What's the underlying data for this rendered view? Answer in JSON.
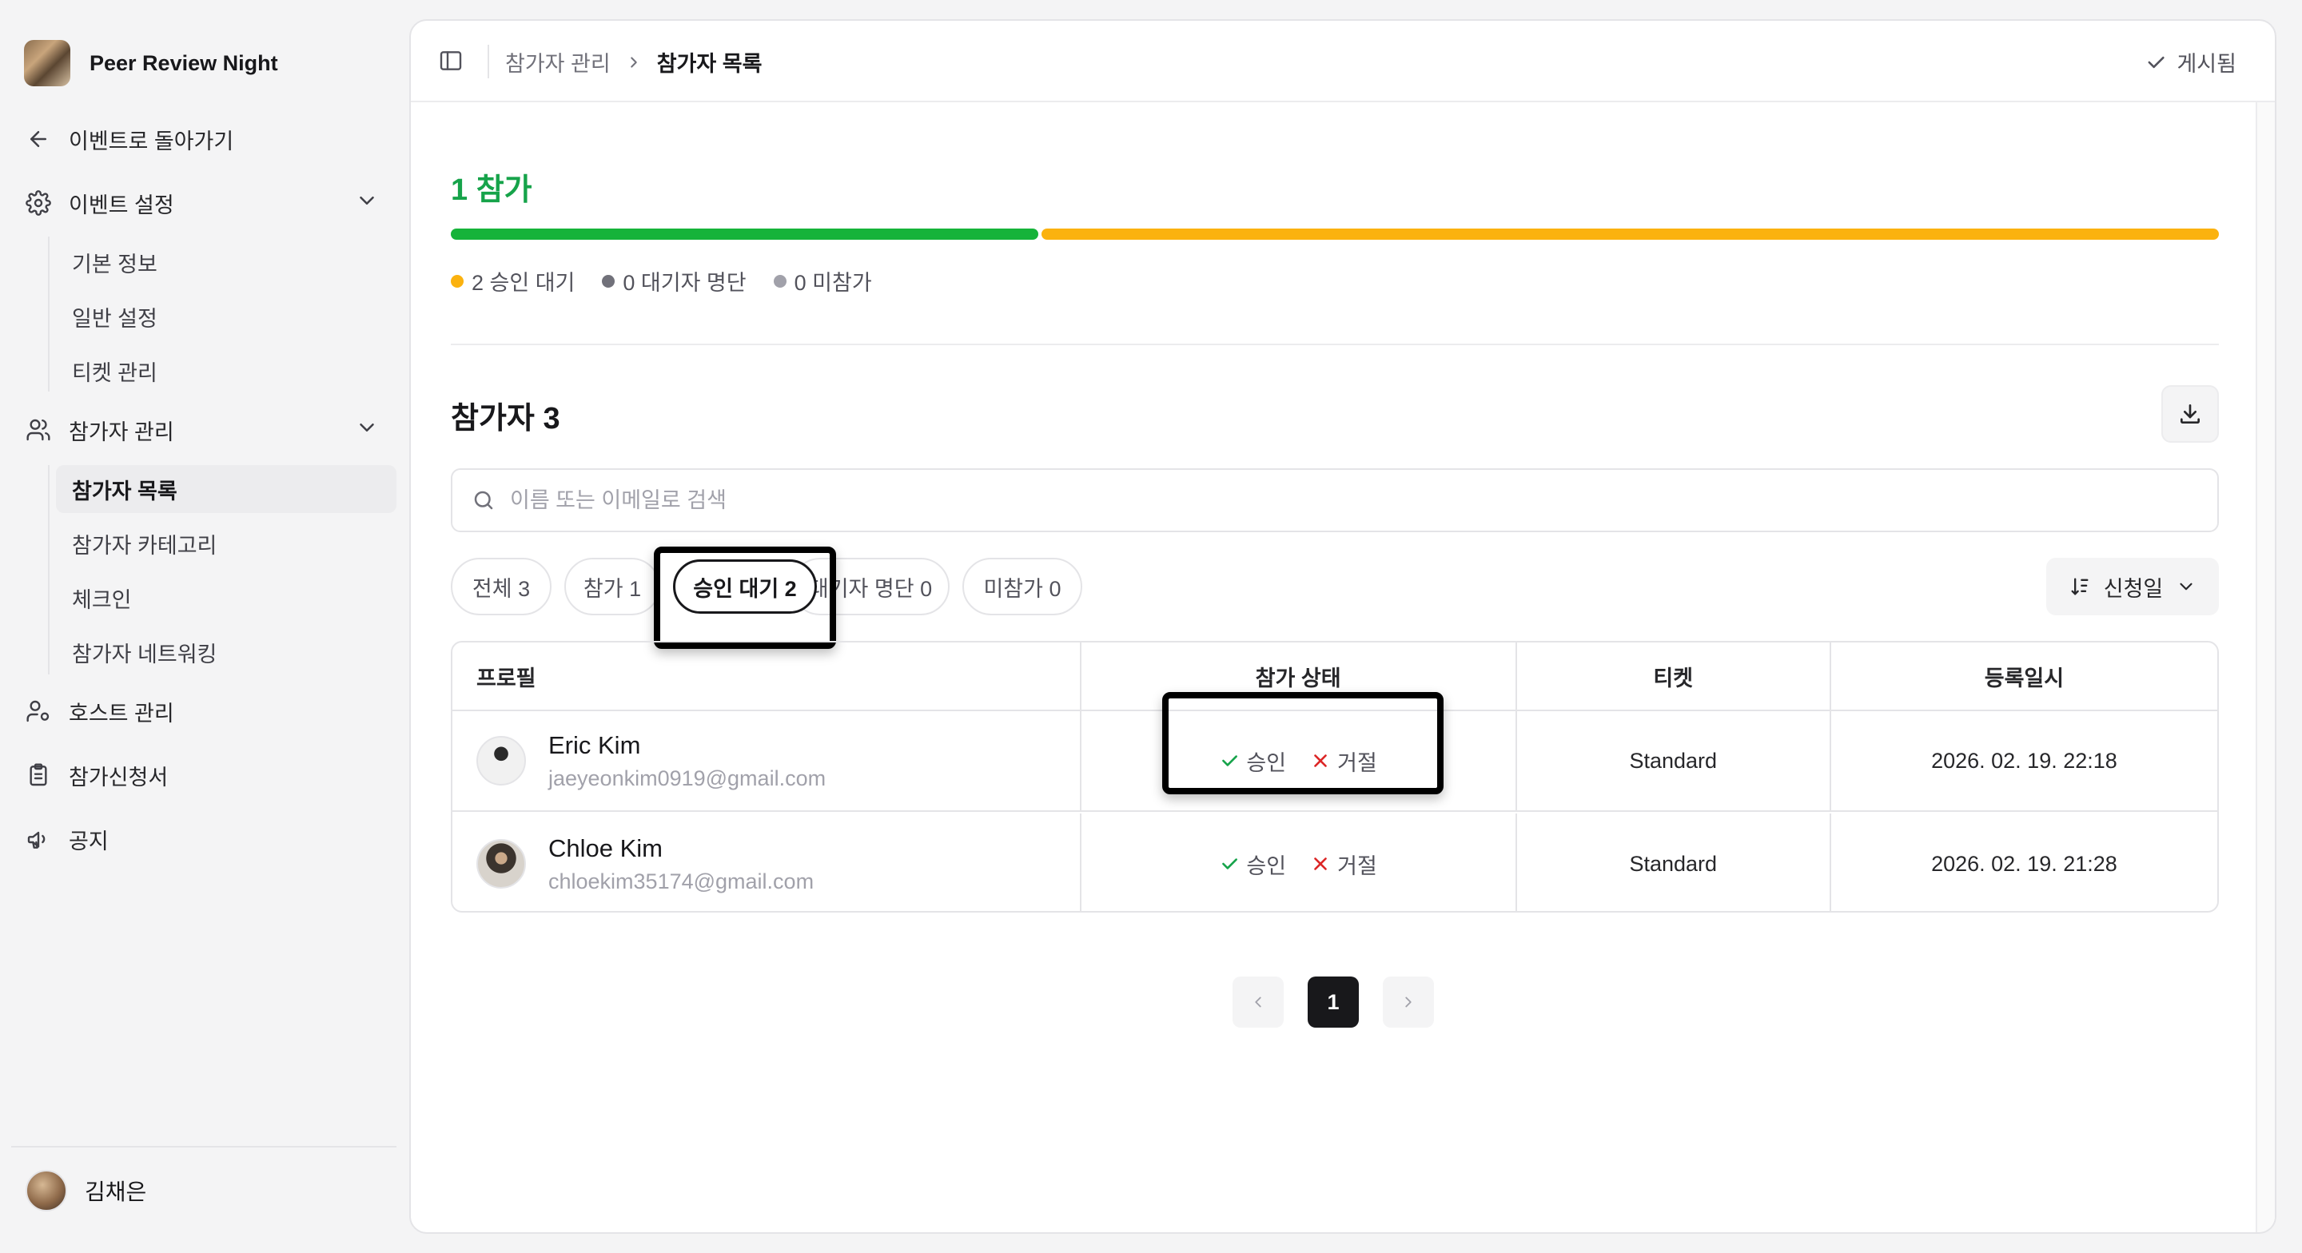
{
  "brand": {
    "name": "Peer Review Night"
  },
  "sidebar": {
    "back_label": "이벤트로 돌아가기",
    "event_settings": {
      "label": "이벤트 설정",
      "items": [
        "기본 정보",
        "일반 설정",
        "티켓 관리"
      ]
    },
    "participants": {
      "label": "참가자 관리",
      "items": [
        "참가자 목록",
        "참가자 카테고리",
        "체크인",
        "참가자 네트워킹"
      ],
      "active_index": 0
    },
    "host_label": "호스트 관리",
    "application_label": "참가신청서",
    "notice_label": "공지",
    "user_name": "김채은"
  },
  "topbar": {
    "breadcrumb_parent": "참가자 관리",
    "breadcrumb_current": "참가자 목록",
    "publish_status": "게시됨"
  },
  "summary": {
    "attend_label": "1 참가",
    "attend_count": 1,
    "pending_count": 2,
    "bar": [
      {
        "key": "attend",
        "fraction": 0.333,
        "color": "#16b33a"
      },
      {
        "key": "pending",
        "fraction": 0.667,
        "color": "#fbb20f"
      }
    ],
    "legend": [
      {
        "text": "2 승인 대기",
        "color": "#fbb20f"
      },
      {
        "text": "0 대기자 명단",
        "color": "#71717a"
      },
      {
        "text": "0 미참가",
        "color": "#a1a1aa"
      }
    ]
  },
  "list": {
    "title": "참가자 3",
    "search_placeholder": "이름 또는 이메일로 검색",
    "filters": [
      {
        "label": "전체 3",
        "active": false
      },
      {
        "label": "참가 1",
        "active": false
      },
      {
        "label": "승인 대기 2",
        "active": true
      },
      {
        "label": "대기자 명단 0",
        "active": false
      },
      {
        "label": "미참가 0",
        "active": false
      }
    ],
    "sort_label": "신청일"
  },
  "table": {
    "columns": [
      "프로필",
      "참가 상태",
      "티켓",
      "등록일시"
    ],
    "approve_label": "승인",
    "reject_label": "거절",
    "rows": [
      {
        "name": "Eric Kim",
        "email": "jaeyeonkim0919@gmail.com",
        "ticket": "Standard",
        "registered": "2026. 02. 19. 22:18"
      },
      {
        "name": "Chloe Kim",
        "email": "chloekim35174@gmail.com",
        "ticket": "Standard",
        "registered": "2026. 02. 19. 21:28"
      }
    ]
  },
  "pagination": {
    "current": "1"
  },
  "colors": {
    "accent_green": "#16a34a",
    "approve_green": "#16a34a",
    "reject_red": "#dc2626"
  }
}
